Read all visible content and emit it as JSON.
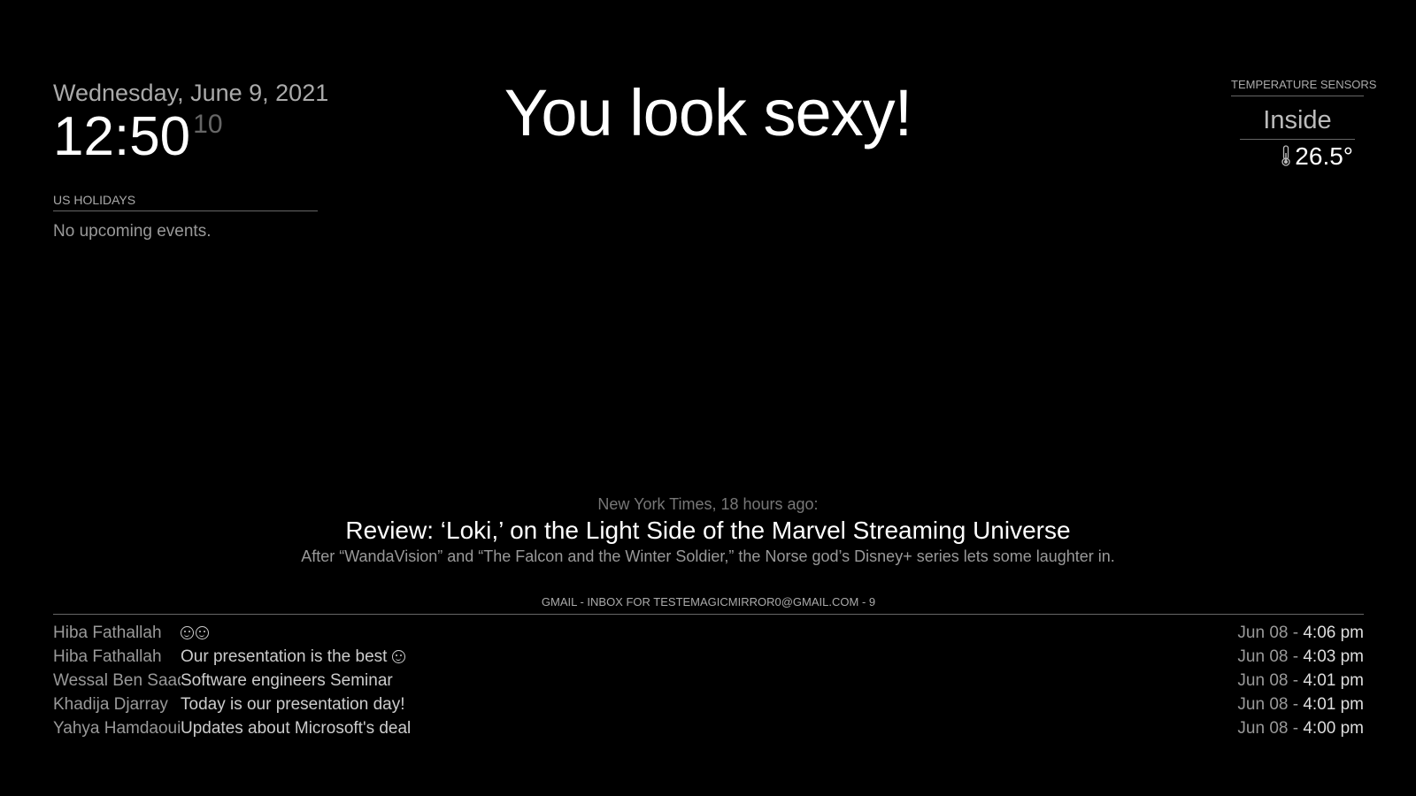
{
  "clock": {
    "date": "Wednesday, June 9, 2021",
    "time": "12:50",
    "seconds": "10"
  },
  "calendar": {
    "header": "US Holidays",
    "empty_text": "No upcoming events."
  },
  "compliment": {
    "text": "You look sexy!"
  },
  "temperature": {
    "header": "Temperature Sensors",
    "room": "Inside",
    "value": "26.5°",
    "icon": "thermometer-icon"
  },
  "news": {
    "source": "New York Times, 18 hours ago:",
    "title": "Review: ‘Loki,’ on the Light Side of the Marvel Streaming Universe",
    "description": "After “WandaVision” and “The Falcon and the Winter Soldier,” the Norse god’s Disney+ series lets some laughter in."
  },
  "gmail": {
    "header": "Gmail - Inbox for testemagicmirror0@gmail.com - 9",
    "messages": [
      {
        "from": "Hiba Fathallah",
        "subject": "",
        "date": "Jun 08 - ",
        "time": "4:06 pm"
      },
      {
        "from": "Hiba Fathallah",
        "subject": "Our presentation is the best ",
        "date": "Jun 08 - ",
        "time": "4:03 pm"
      },
      {
        "from": "Wessal Ben Saad",
        "subject": "Software engineers Seminar",
        "date": "Jun 08 - ",
        "time": "4:01 pm"
      },
      {
        "from": "Khadija Djarray",
        "subject": "Today is our presentation day!",
        "date": "Jun 08 - ",
        "time": "4:01 pm"
      },
      {
        "from": "Yahya Hamdaoui",
        "subject": "Updates about Microsoft's deal",
        "date": "Jun 08 - ",
        "time": "4:00 pm"
      }
    ]
  }
}
